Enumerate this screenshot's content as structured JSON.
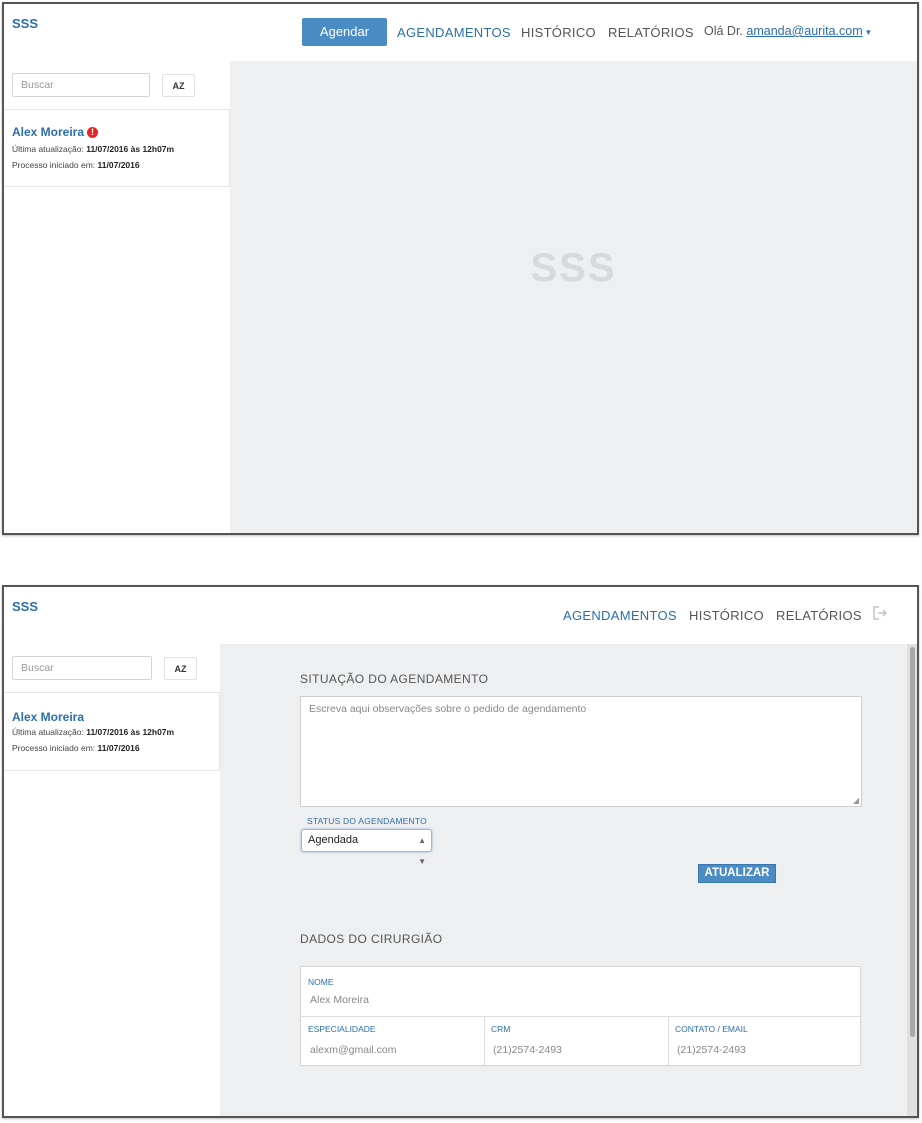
{
  "screen1": {
    "brand": "SSS",
    "nav": {
      "schedule_button": "Agendar",
      "appointments": "AGENDAMENTOS",
      "history": "HISTÓRICO",
      "reports": "RELATÓRIOS",
      "greeting": "Olá Dr.",
      "user_email": "amanda@aurita.com",
      "dropdown_caret": "▾"
    },
    "sidebar": {
      "search_placeholder": "Buscar",
      "sort_label": "AZ",
      "patient": {
        "name": "Alex Moreira",
        "alert_icon": "!",
        "last_update_label": "Última atualização:",
        "last_update_value": "11/07/2016 às 12h07m",
        "started_label": "Processo iniciado em:",
        "started_value": "11/07/2016"
      }
    },
    "main": {
      "watermark": "SSS"
    }
  },
  "screen2": {
    "brand": "SSS",
    "nav": {
      "appointments": "AGENDAMENTOS",
      "history": "HISTÓRICO",
      "reports": "RELATÓRIOS"
    },
    "sidebar": {
      "search_placeholder": "Buscar",
      "sort_label": "AZ",
      "patient": {
        "name": "Alex Moreira",
        "last_update_label": "Última atualização:",
        "last_update_value": "11/07/2016 às 12h07m",
        "started_label": "Processo iniciado em:",
        "started_value": "11/07/2016"
      }
    },
    "appointment_status": {
      "section_title": "SITUAÇÃO DO AGENDAMENTO",
      "notes_placeholder": "Escreva aqui observações sobre o pedido de agendamento",
      "status_label": "STATUS DO AGENDAMENTO",
      "status_value": "Agendada",
      "update_button": "ATUALIZAR"
    },
    "surgeon": {
      "section_title": "DADOS DO CIRURGIÃO",
      "name_label": "NOME",
      "name_value": "Alex Moreira",
      "specialty_label": "ESPECIALIDADE",
      "specialty_value": "alexm@gmail.com",
      "crm_label": "CRM",
      "crm_value": "(21)2574-2493",
      "contact_label": "CONTATO / EMAIL",
      "contact_value": "(21)2574-2493"
    }
  },
  "icons": {
    "logout": "logout-icon",
    "alert": "alert-icon",
    "select_arrows": "updown-arrows-icon"
  },
  "colors": {
    "accent": "#2b6fad",
    "button": "#4b8cc4",
    "main_bg": "#eeeff1",
    "alert": "#e22222"
  }
}
